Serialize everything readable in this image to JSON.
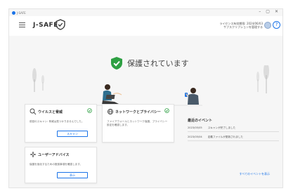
{
  "titlebar": {
    "app_title": "J-SAFE",
    "minimize": "–",
    "maximize": "▢",
    "close": "✕"
  },
  "header": {
    "brand": "J-SAFE",
    "note_line1": "ライセンス有効期限: 2024/06/03",
    "note_line2": "サブスクリプションを管理する",
    "help_label": "?"
  },
  "status": {
    "text": "保護されています"
  },
  "cards": {
    "virus": {
      "title": "ウイルスと脅威",
      "desc": "前回のスキャン: 脅威は見つかりませんでした。",
      "button": "スキャン"
    },
    "firewall": {
      "title": "ネットワークとプライバシー",
      "desc": "ファイアウォールとネットワーク保護、プライバシー設定を確認します。"
    },
    "user": {
      "title": "ユーザーアドバイス",
      "desc": "保護を強化するための推奨事項を確認します。",
      "button": "表示"
    }
  },
  "recent": {
    "title": "最近のイベント",
    "rows": [
      {
        "date": "2023/05/05",
        "text": "スキャンが完了しました"
      },
      {
        "date": "2023/05/04",
        "text": "定義ファイルが更新されました"
      }
    ],
    "link": "すべてのイベントを表示"
  },
  "colors": {
    "accent": "#1a73e8",
    "ok_green": "#2ea043"
  }
}
